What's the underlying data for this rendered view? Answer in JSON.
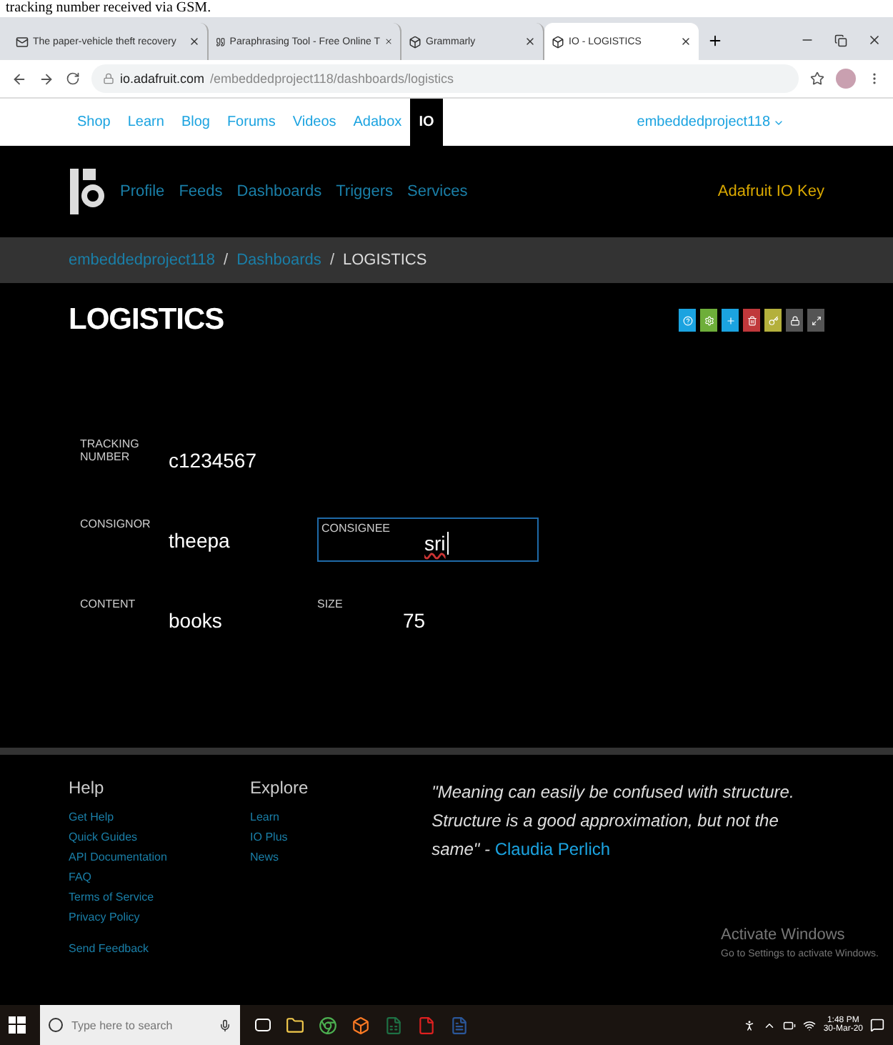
{
  "document_caption": "tracking number received via GSM.",
  "browser_tabs": [
    {
      "title": "The paper-vehicle theft recovery",
      "selected": false
    },
    {
      "title": "Paraphrasing Tool - Free Online T",
      "selected": false
    },
    {
      "title": "Grammarly",
      "selected": false
    },
    {
      "title": "IO - LOGISTICS",
      "selected": true
    }
  ],
  "address_bar": {
    "domain": "io.adafruit.com",
    "path": "/embeddedproject118/dashboards/logistics"
  },
  "site_nav": {
    "links": [
      {
        "label": "Shop",
        "selected": false
      },
      {
        "label": "Learn",
        "selected": false
      },
      {
        "label": "Blog",
        "selected": false
      },
      {
        "label": "Forums",
        "selected": false
      },
      {
        "label": "Videos",
        "selected": false
      },
      {
        "label": "Adabox",
        "selected": false
      },
      {
        "label": "IO",
        "selected": true
      }
    ],
    "account": "embeddedproject118"
  },
  "io_nav": {
    "links": [
      "Profile",
      "Feeds",
      "Dashboards",
      "Triggers",
      "Services"
    ],
    "key_link": "Adafruit IO Key"
  },
  "breadcrumb": [
    {
      "label": "embeddedproject118",
      "kind": "link"
    },
    {
      "label": "/",
      "kind": "separator"
    },
    {
      "label": "Dashboards",
      "kind": "link"
    },
    {
      "label": "/",
      "kind": "separator"
    },
    {
      "label": "LOGISTICS",
      "kind": "current"
    }
  ],
  "dashboard": {
    "title": "LOGISTICS",
    "tools": [
      {
        "color": "#1ba3e0"
      },
      {
        "color": "#6eae3a"
      },
      {
        "color": "#1ba3e0"
      },
      {
        "color": "#c0383b"
      },
      {
        "color": "#b4b03c"
      },
      {
        "color": "#555555"
      },
      {
        "color": "#555555"
      }
    ],
    "blocks": [
      {
        "label": "TRACKING NUMBER",
        "value": "c1234567",
        "kind": "text"
      },
      {
        "label": "CONSIGNOR",
        "value": "theepa",
        "kind": "text"
      },
      {
        "label": "CONSIGNEE",
        "value": "sri",
        "kind": "input"
      },
      {
        "label": "CONTENT",
        "value": "books",
        "kind": "text"
      },
      {
        "label": "SIZE",
        "value": "75",
        "kind": "text"
      }
    ]
  },
  "footer": {
    "columns": [
      {
        "heading": "Help",
        "links": [
          "Get Help",
          "Quick Guides",
          "API Documentation",
          "FAQ",
          "Terms of Service",
          "Privacy Policy"
        ],
        "extra": "Send Feedback"
      },
      {
        "heading": "Explore",
        "links": [
          "Learn",
          "IO Plus",
          "News"
        ]
      }
    ],
    "quote": "\"Meaning can easily be confused with structure. Structure is a good approximation, but not the same\" - ",
    "author": "Claudia Perlich"
  },
  "activation_notice": {
    "title": "Activate Windows",
    "text": "Go to Settings to activate Windows."
  },
  "taskbar": {
    "search_placeholder": "Type here to search",
    "time": "1:48 PM",
    "date": "30-Mar-20"
  }
}
